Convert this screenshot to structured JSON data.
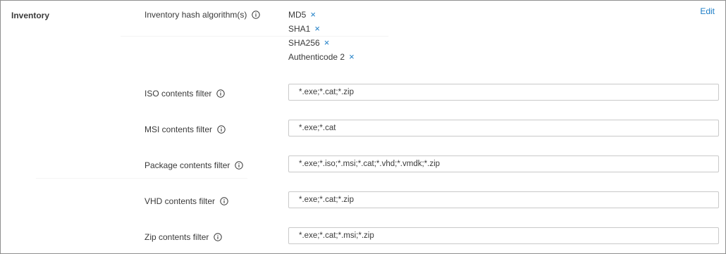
{
  "section": {
    "title": "Inventory",
    "edit_label": "Edit"
  },
  "hash_algorithms": {
    "label": "Inventory hash algorithm(s)",
    "items": [
      {
        "name": "MD5",
        "remove": "×"
      },
      {
        "name": "SHA1",
        "remove": "×"
      },
      {
        "name": "SHA256",
        "remove": "×"
      },
      {
        "name": "Authenticode 2",
        "remove": "×"
      }
    ]
  },
  "filters": [
    {
      "label": "ISO contents filter",
      "value": "*.exe;*.cat;*.zip"
    },
    {
      "label": "MSI contents filter",
      "value": "*.exe;*.cat"
    },
    {
      "label": "Package contents filter",
      "value": "*.exe;*.iso;*.msi;*.cat;*.vhd;*.vmdk;*.zip"
    },
    {
      "label": "VHD contents filter",
      "value": "*.exe;*.cat;*.zip"
    },
    {
      "label": "Zip contents filter",
      "value": "*.exe;*.cat;*.msi;*.zip"
    }
  ],
  "icons": {
    "info": "info-circle-icon",
    "remove": "close-icon"
  },
  "colors": {
    "accent": "#1a7cc6",
    "border": "#8f8f8f",
    "text": "#3a3a3a"
  }
}
